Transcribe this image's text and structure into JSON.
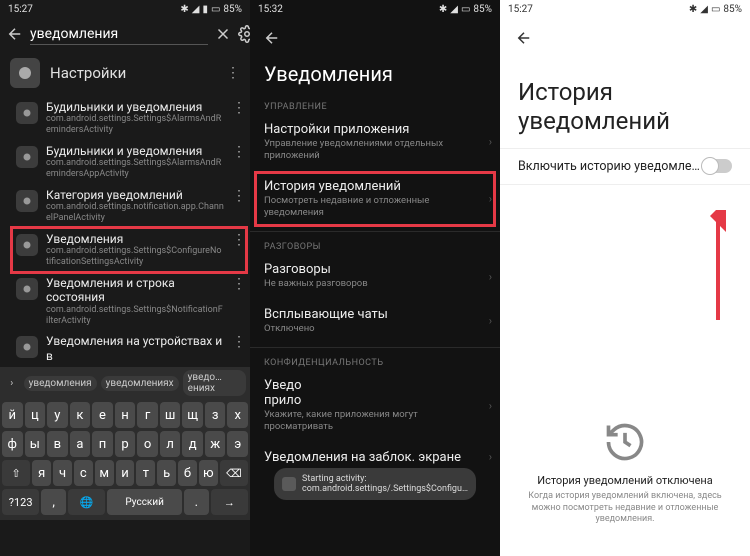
{
  "status": {
    "time1": "15:27",
    "time2": "15:32",
    "time3": "15:27",
    "battery": "85%"
  },
  "panel1": {
    "search_value": "уведомления",
    "cat_title": "Настройки",
    "results": [
      {
        "title": "Будильники и уведомления",
        "sub": "com.android.settings.Settings$AlarmsAndRemindersActivity"
      },
      {
        "title": "Будильники и уведомления",
        "sub": "com.android.settings.Settings$AlarmsAndRemindersAppActivity"
      },
      {
        "title": "Категория уведомлений",
        "sub": "com.android.settings.notification.app.ChannelPanelActivity"
      },
      {
        "title": "Уведомления",
        "sub": "com.android.settings.Settings$ConfigureNotificationSettingsActivity",
        "hl": true
      },
      {
        "title": "Уведомления и строка состояния",
        "sub": "com.android.settings.Settings$NotificationFilterActivity"
      },
      {
        "title": "Уведомления на устройствах и в",
        "sub": ""
      }
    ],
    "suggestions": [
      "уведомления",
      "уведомлениях",
      "уведо…ениях"
    ],
    "kb": {
      "r1": [
        "й",
        "ц",
        "у",
        "к",
        "е",
        "н",
        "г",
        "ш",
        "щ",
        "з",
        "х"
      ],
      "r2": [
        "ф",
        "ы",
        "в",
        "а",
        "п",
        "р",
        "о",
        "л",
        "д",
        "ж",
        "э"
      ],
      "r3": [
        "я",
        "ч",
        "с",
        "м",
        "и",
        "т",
        "ь",
        "б",
        "ю"
      ],
      "shift": "⇧",
      "back": "⌫",
      "sym": "?123",
      "comma": ",",
      "lang": "Русский",
      "period": ".",
      "enter": "→"
    }
  },
  "panel2": {
    "title": "Уведомления",
    "sec1": "УПРАВЛЕНИЕ",
    "items1": [
      {
        "title": "Настройки приложения",
        "sub": "Управление уведомлениями отдельных приложений"
      },
      {
        "title": "История уведомлений",
        "sub": "Посмотреть недавние и отложенные уведомления",
        "hl": true
      }
    ],
    "sec2": "РАЗГОВОРЫ",
    "items2": [
      {
        "title": "Разговоры",
        "sub": "Не важных разговоров"
      },
      {
        "title": "Всплывающие чаты",
        "sub": "Отключено"
      }
    ],
    "sec3": "КОНФИДЕНЦИАЛЬНОСТЬ",
    "items3": [
      {
        "title": "Уведо",
        "title2": "прило",
        "sub": "Укажите, какие приложения могут просматривать"
      },
      {
        "title": "Уведомления на заблок. экране",
        "sub": ""
      }
    ],
    "toast": "Starting activity: com.android.settings/.Settings$Configu…"
  },
  "panel3": {
    "title": "История уведомлений",
    "toggle_label": "Включить историю уведомле…",
    "empty_title": "История уведомлений отключена",
    "empty_sub": "Когда история уведомлений включена, здесь можно посмотреть недавние и отложенные уведомления."
  }
}
